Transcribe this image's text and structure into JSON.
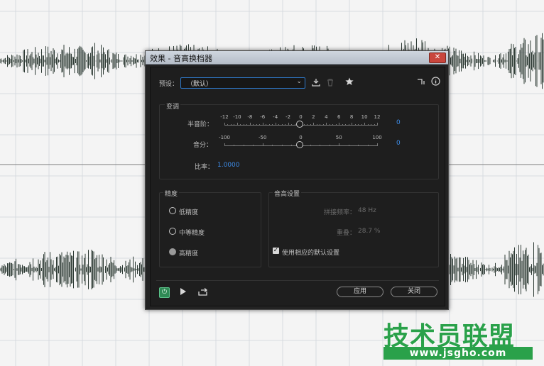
{
  "dialog": {
    "title": "效果 - 音高换档器",
    "close_glyph": "✕",
    "preset_label": "预设：",
    "preset_value": "（默认）"
  },
  "pitch": {
    "section_label": "变调",
    "semitone_label": "半音阶：",
    "semitone_value": "0",
    "semitone_ticks": [
      "-12",
      "-10",
      "-8",
      "-6",
      "-4",
      "-2",
      "0",
      "2",
      "4",
      "6",
      "8",
      "10",
      "12"
    ],
    "cents_label": "音分：",
    "cents_value": "0",
    "cents_ticks": [
      "-100",
      "-50",
      "0",
      "50",
      "100"
    ],
    "ratio_label": "比率：",
    "ratio_value": "1.0000"
  },
  "precision": {
    "section_label": "精度",
    "options": [
      "低精度",
      "中等精度",
      "高精度"
    ],
    "selected": 2
  },
  "pitch_settings": {
    "section_label": "音高设置",
    "splice_label": "拼接频率：",
    "splice_value": "48 Hz",
    "overlap_label": "重叠：",
    "overlap_value": "28.7 %",
    "default_checkbox_label": "使用相应的默认设置",
    "default_checked": true
  },
  "footer": {
    "apply_label": "应用",
    "close_label": "关闭"
  },
  "watermark": {
    "text": "技术员联盟",
    "url": "www.jsgho.com"
  },
  "colors": {
    "accent": "#3d8be6",
    "waveform": "#2e3b35",
    "watermark": "#2aa14a"
  }
}
